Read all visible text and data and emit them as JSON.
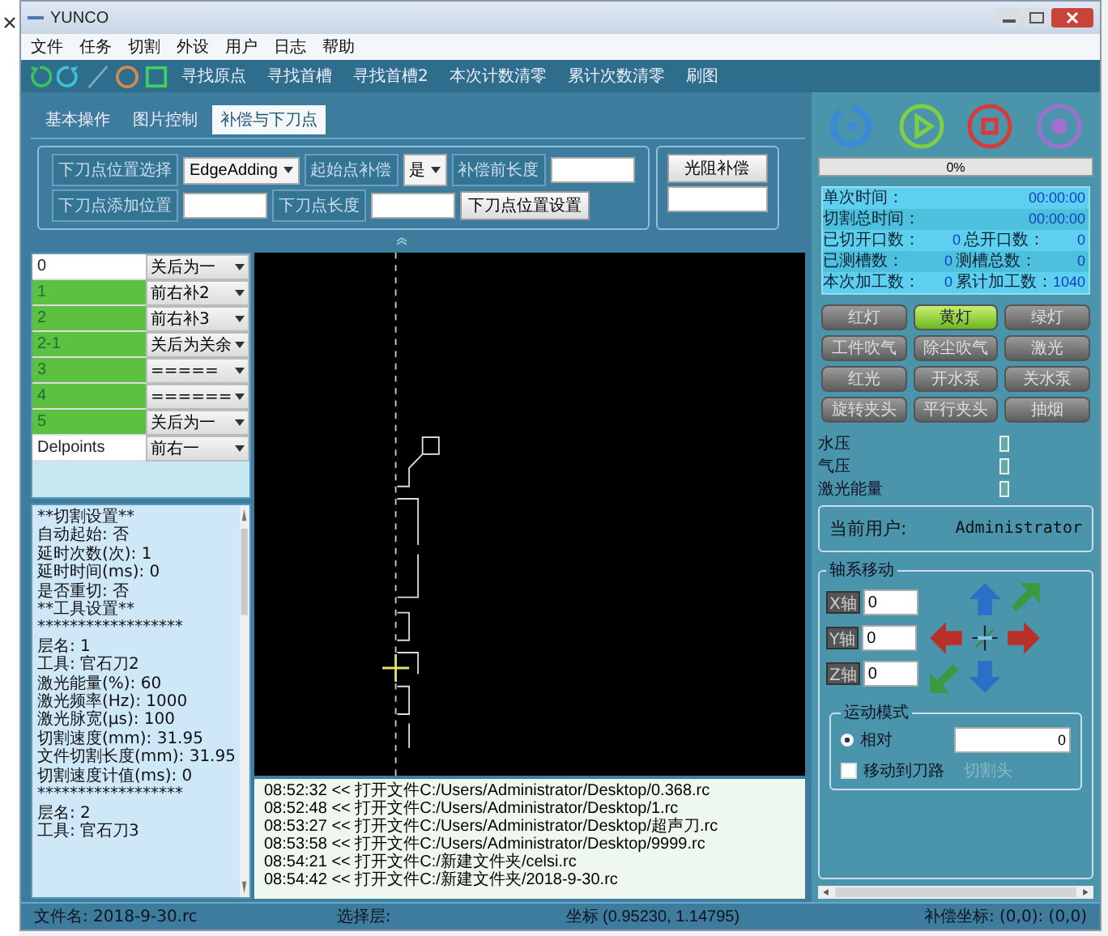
{
  "window": {
    "title": "YUNCO"
  },
  "menu": [
    "文件",
    "任务",
    "切割",
    "外设",
    "用户",
    "日志",
    "帮助"
  ],
  "toolbar": {
    "buttons": [
      "寻找原点",
      "寻找首槽",
      "寻找首槽2",
      "本次计数清零",
      "累计次数清零",
      "刷图"
    ]
  },
  "tabs": [
    {
      "label": "基本操作",
      "selected": false
    },
    {
      "label": "图片控制",
      "selected": false
    },
    {
      "label": "补偿与下刀点",
      "selected": true
    }
  ],
  "form": {
    "row_1": [
      {
        "kind": "label",
        "text": "下刀点位置选择"
      },
      {
        "kind": "select",
        "value": "EdgeAdding"
      },
      {
        "kind": "label",
        "text": "起始点补偿"
      },
      {
        "kind": "select",
        "value": "是"
      },
      {
        "kind": "label",
        "text": "补偿前长度"
      },
      {
        "kind": "input"
      }
    ],
    "row_2": [
      {
        "kind": "label",
        "text": "下刀点添加位置"
      },
      {
        "kind": "input"
      },
      {
        "kind": "label",
        "text": "下刀点长度"
      },
      {
        "kind": "input"
      },
      {
        "kind": "button",
        "text": "下刀点位置设置"
      }
    ],
    "side_button": "光阻补偿"
  },
  "layers": [
    {
      "name": "0",
      "option": "关后为一",
      "active": false
    },
    {
      "name": "1",
      "option": "前右补2",
      "active": true
    },
    {
      "name": "2",
      "option": "前右补3",
      "active": true
    },
    {
      "name": "2-1",
      "option": "关后为关余",
      "active": true
    },
    {
      "name": "3",
      "option": "=====",
      "active": true
    },
    {
      "name": "4",
      "option": "======",
      "active": true
    },
    {
      "name": "5",
      "option": "关后为一",
      "active": true
    },
    {
      "name": "Delpoints",
      "option": "前右一",
      "active": false
    }
  ],
  "params": [
    "**切割设置**",
    "自动起始: 否",
    "延时次数(次): 1",
    "延时时间(ms): 0",
    "是否重切: 否",
    "**工具设置**",
    "******************",
    "层名: 1",
    "工具: 官石刀2",
    "激光能量(%): 60",
    "激光频率(Hz): 1000",
    "激光脉宽(μs): 100",
    "切割速度(mm): 31.95",
    "文件切割长度(mm): 31.95",
    "切割速度计值(ms): 0",
    "******************",
    "层名: 2",
    "工具: 官石刀3"
  ],
  "log": [
    "08:52:32 << 打开文件C:/Users/Administrator/Desktop/0.368.rc",
    "08:52:48 << 打开文件C:/Users/Administrator/Desktop/1.rc",
    "08:53:27 << 打开文件C:/Users/Administrator/Desktop/超声刀.rc",
    "08:53:58 << 打开文件C:/Users/Administrator/Desktop/9999.rc",
    "08:54:21 << 打开文件C:/新建文件夹/celsi.rc",
    "08:54:42 << 打开文件C:/新建文件夹/2018-9-30.rc"
  ],
  "status_bar": {
    "file_label": "文件名:",
    "file_name": "2018-9-30.rc",
    "layer_label": "选择层:",
    "coord_label": "坐标",
    "coord_value": "(0.95230, 1.14795)",
    "offset": "补偿坐标: (0,0): (0,0)"
  },
  "progress": {
    "level": 0,
    "reading": "0%"
  },
  "info": [
    {
      "cells": [
        {
          "label": "单次时间：",
          "value": "00:00:00"
        }
      ]
    },
    {
      "cells": [
        {
          "label": "切割总时间：",
          "value": "00:00:00"
        }
      ]
    },
    {
      "cells": [
        {
          "label": "已切开口数：",
          "value": "0"
        },
        {
          "label": "总开口数：",
          "value": "0"
        }
      ]
    },
    {
      "cells": [
        {
          "label": "已测槽数：",
          "value": "0"
        },
        {
          "label": "测槽总数：",
          "value": "0"
        }
      ]
    },
    {
      "cells": [
        {
          "label": "本次加工数：",
          "value": "0"
        },
        {
          "label": "累计加工数：",
          "value": "1040"
        }
      ]
    }
  ],
  "controls": [
    {
      "label": "红灯",
      "on": false
    },
    {
      "label": "黄灯",
      "on": true
    },
    {
      "label": "绿灯",
      "on": false
    },
    {
      "label": "工件吹气",
      "on": false
    },
    {
      "label": "除尘吹气",
      "on": false
    },
    {
      "label": "激光",
      "on": false
    },
    {
      "label": "红光",
      "on": false
    },
    {
      "label": "开水泵",
      "on": false
    },
    {
      "label": "关水泵",
      "on": false
    },
    {
      "label": "旋转夹头",
      "on": false
    },
    {
      "label": "平行夹头",
      "on": false
    },
    {
      "label": "抽烟",
      "on": false
    }
  ],
  "indicators": [
    {
      "label": "水压",
      "on": false
    },
    {
      "label": "气压",
      "on": false
    },
    {
      "label": "激光能量",
      "on": false
    }
  ],
  "current_user": {
    "label": "当前用户:",
    "value": "Administrator"
  },
  "axis": {
    "title": "轴系移动",
    "axes": [
      {
        "label": "X轴",
        "value": "0"
      },
      {
        "label": "Y轴",
        "value": "0"
      },
      {
        "label": "Z轴",
        "value": "0"
      }
    ],
    "mode": {
      "title": "运动模式",
      "relative": {
        "label": "相对",
        "checked": true,
        "value": "0"
      },
      "move_to": {
        "label": "移动到刀路",
        "checked": false,
        "value": "切割头"
      }
    }
  }
}
